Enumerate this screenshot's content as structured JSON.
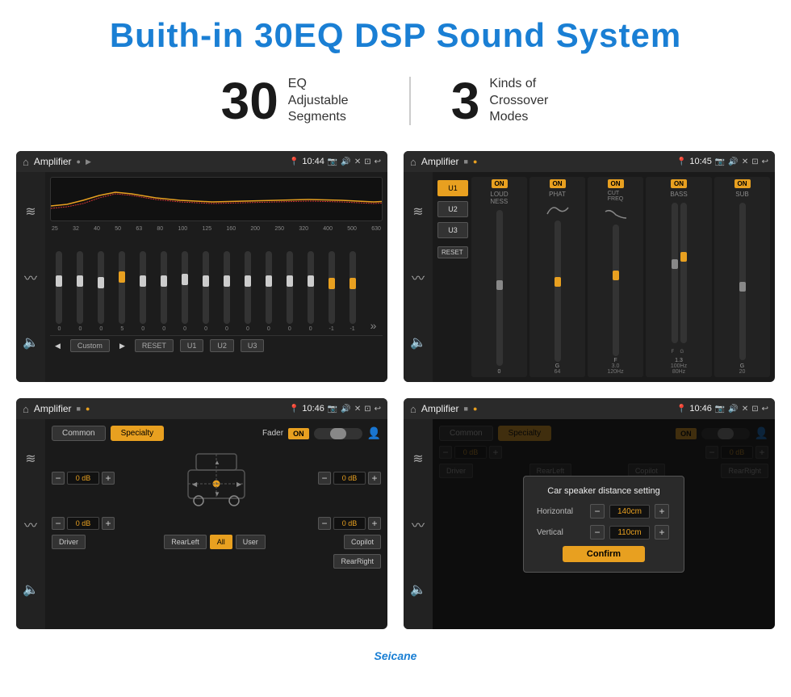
{
  "page": {
    "title": "Buith-in 30EQ DSP Sound System",
    "stats": [
      {
        "number": "30",
        "label": "EQ Adjustable\nSegments"
      },
      {
        "number": "3",
        "label": "Kinds of\nCrossover Modes"
      }
    ]
  },
  "screens": {
    "screen1": {
      "title": "Amplifier",
      "time": "10:44",
      "freq_labels": [
        "25",
        "32",
        "40",
        "50",
        "63",
        "80",
        "100",
        "125",
        "160",
        "200",
        "250",
        "320",
        "400",
        "500",
        "630"
      ],
      "preset_label": "Custom",
      "reset_label": "RESET",
      "presets": [
        "U1",
        "U2",
        "U3"
      ]
    },
    "screen2": {
      "title": "Amplifier",
      "time": "10:45",
      "channels": [
        {
          "label": "LOUDNESS",
          "toggle": "ON"
        },
        {
          "label": "PHAT",
          "toggle": "ON"
        },
        {
          "label": "CUT FREQ",
          "toggle": "ON"
        },
        {
          "label": "BASS",
          "toggle": "ON"
        },
        {
          "label": "SUB",
          "toggle": "ON"
        }
      ],
      "presets": [
        "U1",
        "U2",
        "U3"
      ],
      "reset_label": "RESET"
    },
    "screen3": {
      "title": "Amplifier",
      "time": "10:46",
      "tabs": [
        "Common",
        "Specialty"
      ],
      "active_tab": "Specialty",
      "fader_label": "Fader",
      "fader_toggle": "ON",
      "speaker_values": [
        "0 dB",
        "0 dB",
        "0 dB",
        "0 dB"
      ],
      "buttons": [
        "Driver",
        "RearLeft",
        "All",
        "User",
        "Copilot",
        "RearRight"
      ]
    },
    "screen4": {
      "title": "Amplifier",
      "time": "10:46",
      "tabs": [
        "Common",
        "Specialty"
      ],
      "active_tab": "Specialty",
      "fader_toggle": "ON",
      "speaker_values": [
        "0 dB",
        "0 dB"
      ],
      "dialog": {
        "title": "Car speaker distance setting",
        "horizontal_label": "Horizontal",
        "horizontal_value": "140cm",
        "vertical_label": "Vertical",
        "vertical_value": "110cm",
        "confirm_label": "Confirm",
        "db_values": [
          "0 dB",
          "0 dB"
        ]
      },
      "buttons": [
        "Driver",
        "RearLeft",
        "Copilot",
        "RearRight"
      ]
    }
  },
  "watermark": "Seicane",
  "icons": {
    "home": "⌂",
    "back": "↩",
    "camera": "📷",
    "volume": "🔊",
    "close": "✕",
    "minimize": "—",
    "person": "👤",
    "eq": "≋",
    "wave": "〰",
    "speaker": "🔈",
    "prev": "◀",
    "next": "▶",
    "minus": "−",
    "plus": "+"
  }
}
